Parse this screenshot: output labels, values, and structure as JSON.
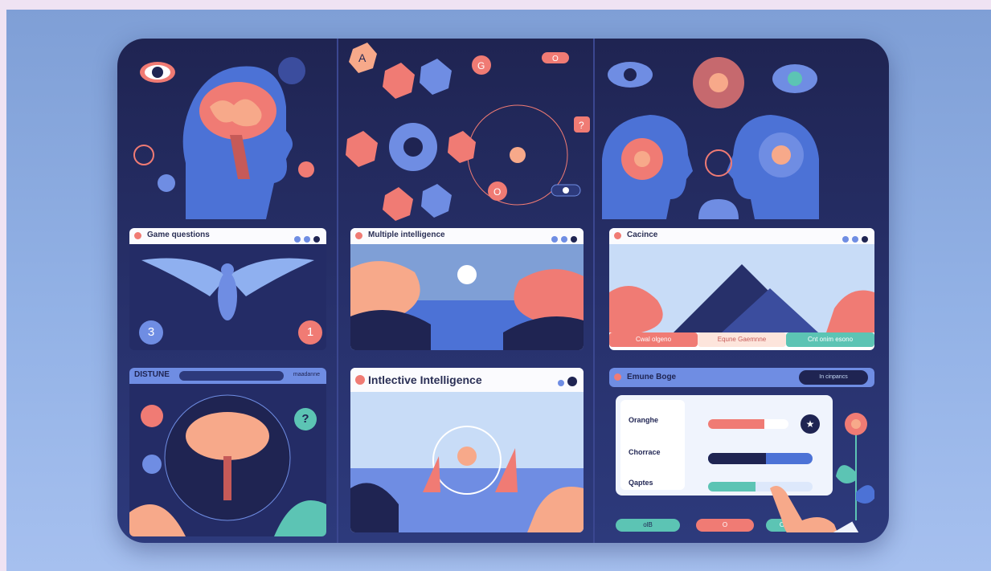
{
  "panels": {
    "game_questions": {
      "title": "Game questions",
      "left_badge": "3",
      "right_badge": "1"
    },
    "multiple_intelligence": {
      "title": "Multiple intelligence"
    },
    "science": {
      "title": "Cacince",
      "buttons": [
        "Cwal olgeno",
        "Equne Gaemnne",
        "Cnt onim esono"
      ]
    },
    "disture": {
      "title": "DISTUNE",
      "field_text": "maadanne",
      "badge": "?"
    },
    "interactive": {
      "title": "Intlective Intelligence"
    },
    "settings": {
      "title": "Emune Boge",
      "chip": "In cinpancs",
      "rows": [
        {
          "label": "Oranghe",
          "level": 0.7
        },
        {
          "label": "Chorrace",
          "level": 0.55
        },
        {
          "label": "Qaptes",
          "level": 0.45
        }
      ],
      "footer_buttons": [
        "olB",
        "O",
        "O"
      ]
    }
  },
  "top_letters": [
    "A",
    "G",
    "O",
    "O",
    "O",
    "O",
    "?"
  ],
  "colors": {
    "accent": "#6f8de3",
    "coral": "#f07b74",
    "teal": "#5cc4b4",
    "navy": "#1f2452",
    "peach": "#f7a98a"
  }
}
